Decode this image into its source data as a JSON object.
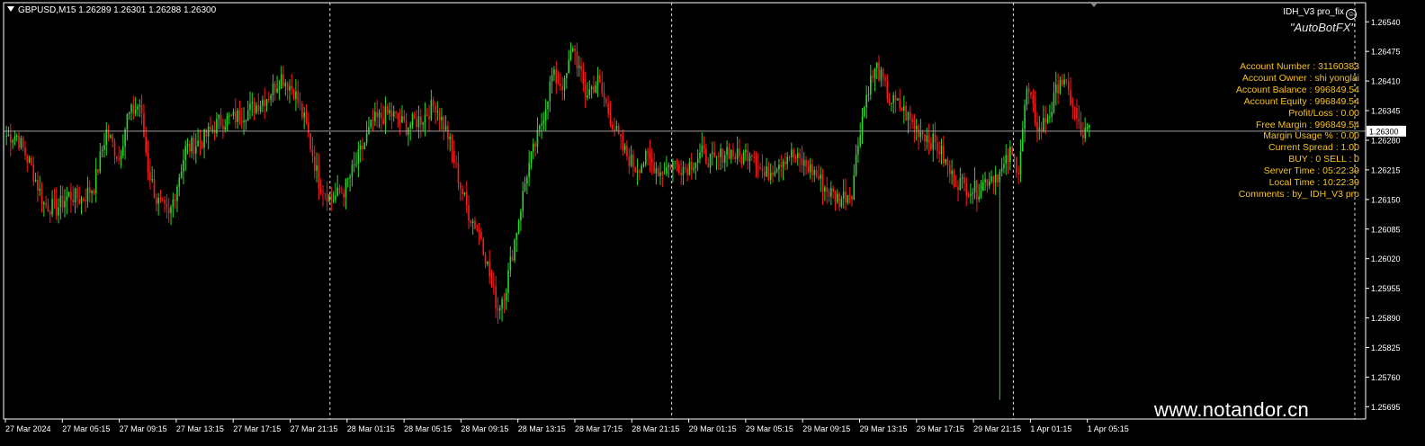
{
  "header": {
    "symbol_line": "GBPUSD,M15  1.26289 1.26301 1.26288 1.26300",
    "ea_name": "IDH_V3 pro_fix",
    "ea_icon": "smiley-icon",
    "brand": "\"AutoBotFX\""
  },
  "info_panel": [
    "Account Number : 31160383",
    "Account Owner : shi yonglai",
    "Account Balance : 996849.54",
    "Account Equity : 996849.54",
    "Profit/Loss : 0.00",
    "Free Margin : 996849.54",
    "Margin Usage % : 0.00",
    "Current Spread : 1.00",
    "BUY : 0 SELL : 0",
    "Server Time : 05:22:39",
    "Local Time : 10:22:39",
    "Comments : by_ IDH_V3 pro"
  ],
  "watermark": "www.notandor.cn",
  "colors": {
    "background": "#000000",
    "bull": "#2bd52b",
    "bear": "#ff1a1a",
    "bid_line": "#a0a0a0",
    "panel_text": "#f6c21f",
    "axis": "#ffffff"
  },
  "chart_data": {
    "type": "candlestick",
    "symbol": "GBPUSD",
    "timeframe": "M15",
    "ylim": [
      1.25668,
      1.26578
    ],
    "y_ticks": [
      "1.26540",
      "1.26475",
      "1.26410",
      "1.26345",
      "1.26280",
      "1.26215",
      "1.26150",
      "1.26085",
      "1.26020",
      "1.25955",
      "1.25890",
      "1.25825",
      "1.25760",
      "1.25695"
    ],
    "current_price": "1.26300",
    "x_tick_labels": [
      "27 Mar 2024",
      "27 Mar 05:15",
      "27 Mar 09:15",
      "27 Mar 13:15",
      "27 Mar 17:15",
      "27 Mar 21:15",
      "28 Mar 01:15",
      "28 Mar 05:15",
      "28 Mar 09:15",
      "28 Mar 13:15",
      "28 Mar 17:15",
      "28 Mar 21:15",
      "29 Mar 01:15",
      "29 Mar 05:15",
      "29 Mar 09:15",
      "29 Mar 13:15",
      "29 Mar 17:15",
      "29 Mar 21:15",
      "1 Apr 01:15",
      "1 Apr 05:15"
    ],
    "day_separators_at_tick_fraction": [
      5.7,
      11.7,
      17.7
    ],
    "anchors": [
      [
        0,
        1.2629
      ],
      [
        5,
        1.2629
      ],
      [
        12,
        1.2622
      ],
      [
        18,
        1.2614
      ],
      [
        24,
        1.2613
      ],
      [
        30,
        1.2616
      ],
      [
        36,
        1.2615
      ],
      [
        42,
        1.2618
      ],
      [
        48,
        1.263
      ],
      [
        54,
        1.2624
      ],
      [
        58,
        1.2633
      ],
      [
        64,
        1.2636
      ],
      [
        68,
        1.2622
      ],
      [
        72,
        1.2615
      ],
      [
        78,
        1.2611
      ],
      [
        86,
        1.2626
      ],
      [
        94,
        1.2628
      ],
      [
        102,
        1.2632
      ],
      [
        110,
        1.2633
      ],
      [
        118,
        1.2635
      ],
      [
        126,
        1.2638
      ],
      [
        132,
        1.2642
      ],
      [
        138,
        1.2639
      ],
      [
        144,
        1.2631
      ],
      [
        150,
        1.2619
      ],
      [
        156,
        1.2615
      ],
      [
        162,
        1.2617
      ],
      [
        168,
        1.2623
      ],
      [
        176,
        1.2632
      ],
      [
        184,
        1.2634
      ],
      [
        192,
        1.2631
      ],
      [
        200,
        1.2633
      ],
      [
        206,
        1.2636
      ],
      [
        212,
        1.2629
      ],
      [
        218,
        1.2618
      ],
      [
        222,
        1.2612
      ],
      [
        228,
        1.2607
      ],
      [
        233,
        1.2596
      ],
      [
        236,
        1.2591
      ],
      [
        240,
        1.2596
      ],
      [
        244,
        1.2606
      ],
      [
        250,
        1.2621
      ],
      [
        256,
        1.263
      ],
      [
        262,
        1.2642
      ],
      [
        268,
        1.264
      ],
      [
        272,
        1.2649
      ],
      [
        278,
        1.2638
      ],
      [
        284,
        1.2641
      ],
      [
        290,
        1.2633
      ],
      [
        296,
        1.2626
      ],
      [
        302,
        1.2622
      ],
      [
        308,
        1.2624
      ],
      [
        314,
        1.2621
      ],
      [
        320,
        1.2623
      ],
      [
        326,
        1.2622
      ],
      [
        334,
        1.2625
      ],
      [
        340,
        1.2623
      ],
      [
        346,
        1.2626
      ],
      [
        352,
        1.2624
      ],
      [
        358,
        1.2626
      ],
      [
        364,
        1.262
      ],
      [
        370,
        1.2623
      ],
      [
        376,
        1.2625
      ],
      [
        382,
        1.2623
      ],
      [
        388,
        1.2621
      ],
      [
        394,
        1.2617
      ],
      [
        400,
        1.2615
      ],
      [
        406,
        1.2617
      ],
      [
        410,
        1.2631
      ],
      [
        414,
        1.264
      ],
      [
        418,
        1.2644
      ],
      [
        424,
        1.2637
      ],
      [
        430,
        1.2635
      ],
      [
        436,
        1.2631
      ],
      [
        442,
        1.2629
      ],
      [
        448,
        1.2626
      ],
      [
        454,
        1.262
      ],
      [
        460,
        1.2618
      ],
      [
        466,
        1.2617
      ],
      [
        472,
        1.262
      ],
      [
        478,
        1.2621
      ],
      [
        482,
        1.2625
      ],
      [
        486,
        1.2622
      ],
      [
        490,
        1.2639
      ],
      [
        496,
        1.263
      ],
      [
        502,
        1.2635
      ],
      [
        506,
        1.2642
      ],
      [
        512,
        1.2636
      ],
      [
        516,
        1.2629
      ],
      [
        520,
        1.263
      ]
    ],
    "spike_low": {
      "index": 477,
      "low": 1.2571
    }
  }
}
